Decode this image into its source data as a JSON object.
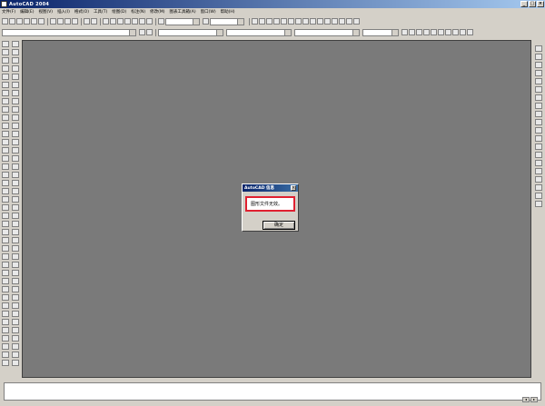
{
  "window": {
    "title": "AutoCAD 2004",
    "controls": [
      "_",
      "□",
      "×"
    ]
  },
  "menubar": {
    "items": [
      "文件(F)",
      "编辑(E)",
      "视图(V)",
      "插入(I)",
      "格式(O)",
      "工具(T)",
      "绘图(D)",
      "标注(N)",
      "修改(M)",
      "图表工具箱(A)",
      "窗口(W)",
      "帮助(H)"
    ]
  },
  "dialog": {
    "title": "AutoCAD 信息",
    "message": "图形文件无效。",
    "ok_label": "确定"
  }
}
